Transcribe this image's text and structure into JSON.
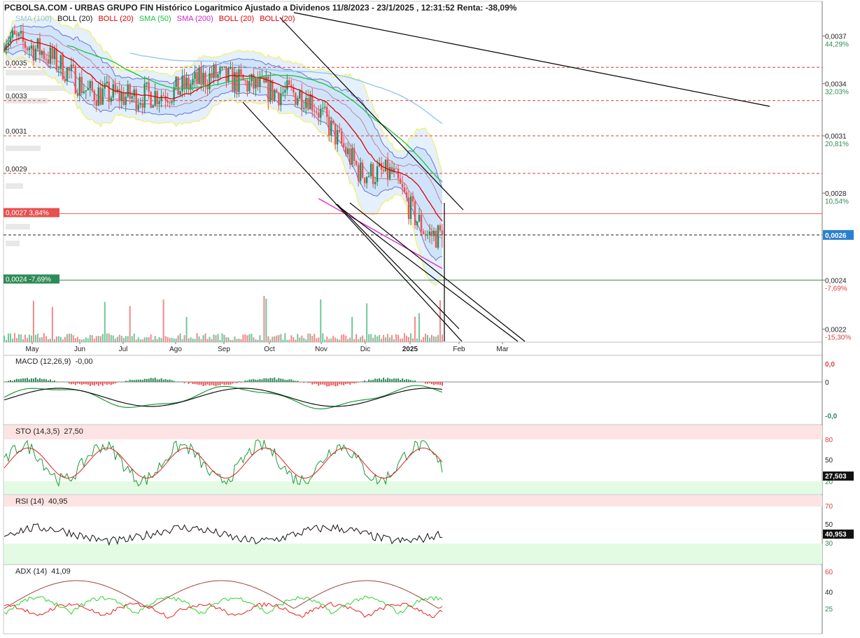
{
  "header": {
    "title": "PCBOLSA.COM - URBAS GRUPO FIN Histórico Logaritmico Ajustado a Dividenos 11/8/2023 - 23/1/2025 , 12:31:52 Renta: -38,09%"
  },
  "legend": [
    {
      "label": "SMA (100)",
      "color": "#8fc3f0"
    },
    {
      "label": "BOLL (20)",
      "color": "#111111"
    },
    {
      "label": "BOLL (20)",
      "color": "#e00000"
    },
    {
      "label": "SMA (50)",
      "color": "#19c23d"
    },
    {
      "label": "SMA (200)",
      "color": "#d61fcf"
    },
    {
      "label": "BOLL (20)",
      "color": "#e00000"
    },
    {
      "label": "BOLL (20)",
      "color": "#e00000"
    }
  ],
  "colors": {
    "up": "#2e8b57",
    "down": "#f05050",
    "bollinger_fill": "#cfe4fa",
    "bollinger_outer": "#f0f04a",
    "sma50": "#19c23d",
    "sma100": "#8fc3f0",
    "sma200": "#d61fcf",
    "boll_mid": "#e00000",
    "trendline": "#000000",
    "zone_red": "#fde3e3",
    "zone_green": "#e2fbe2",
    "last_price_bg": "#2a80d0"
  },
  "x_axis_labels": [
    "May",
    "Jun",
    "Jul",
    "Ago",
    "Sep",
    "Oct",
    "Nov",
    "Dic",
    "2025",
    "Feb",
    "Mar"
  ],
  "price_axis": {
    "ticks": [
      {
        "price": "0,0037",
        "pct": "44,29%",
        "dir": "up"
      },
      {
        "price": "0,0034",
        "pct": "32,03%",
        "dir": "up"
      },
      {
        "price": "0,0031",
        "pct": "20,81%",
        "dir": "up"
      },
      {
        "price": "0,0028",
        "pct": "10,54%",
        "dir": "up"
      },
      {
        "price": "0,0024",
        "pct": "-7,69%",
        "dir": "down"
      },
      {
        "price": "0,0022",
        "pct": "-15,30%",
        "dir": "down"
      }
    ],
    "last_price": "0,0026"
  },
  "left_levels": [
    {
      "label": "0,0035",
      "kind": "plain"
    },
    {
      "label": "0,0033",
      "kind": "plain"
    },
    {
      "label": "0,0031",
      "kind": "plain"
    },
    {
      "label": "0,0029",
      "kind": "plain"
    },
    {
      "label": "0,0027  3,84%",
      "kind": "red"
    },
    {
      "label": "0,0024  -7,69%",
      "kind": "green"
    }
  ],
  "panels": {
    "macd": {
      "name": "MACD (12,26,9)",
      "value": "-0,00",
      "ticks": [
        "0,0",
        "0",
        "-0,0"
      ]
    },
    "sto": {
      "name": "STO (14,3,5)",
      "value": "27,50",
      "ticks": [
        "80",
        "50",
        "20"
      ],
      "last": "27,503"
    },
    "rsi": {
      "name": "RSI (14)",
      "value": "40,95",
      "ticks": [
        "70",
        "50",
        "30"
      ],
      "last": "40,953"
    },
    "adx": {
      "name": "ADX (14)",
      "value": "41,09",
      "ticks": [
        "60",
        "40",
        "25"
      ]
    }
  },
  "chart_data": {
    "type": "candlestick",
    "title": "PCBOLSA.COM - URBAS GRUPO FIN Histórico Logaritmico Ajustado a Dividenos 11/8/2023 - 23/1/2025 , 12:31:52 Renta: -38,09%",
    "y_scale": "log",
    "ylim": [
      0.00215,
      0.0038
    ],
    "months": [
      "May",
      "Jun",
      "Jul",
      "Ago",
      "Sep",
      "Oct",
      "Nov",
      "Dic",
      "2025",
      "Feb",
      "Mar"
    ],
    "horizontal_levels": [
      0.0035,
      0.0033,
      0.0031,
      0.0029,
      0.0027,
      0.0026,
      0.0024
    ],
    "last_close": 0.0026,
    "return_pct": -38.09,
    "close_path": [
      [
        "May",
        0.0037
      ],
      [
        "Jun",
        0.0035
      ],
      [
        "Jul",
        0.00335
      ],
      [
        "Ago",
        0.00335
      ],
      [
        "Sep",
        0.00345
      ],
      [
        "Oct",
        0.00335
      ],
      [
        "Nov",
        0.0029
      ],
      [
        "Dic",
        0.0029
      ],
      [
        "2025",
        0.0026
      ],
      [
        "2025",
        0.0026
      ]
    ],
    "indicators": {
      "MACD (12,26,9)": -0.0,
      "STO (14,3,5)": 27.5,
      "RSI (14)": 40.95,
      "ADX (14)": 41.09
    }
  }
}
